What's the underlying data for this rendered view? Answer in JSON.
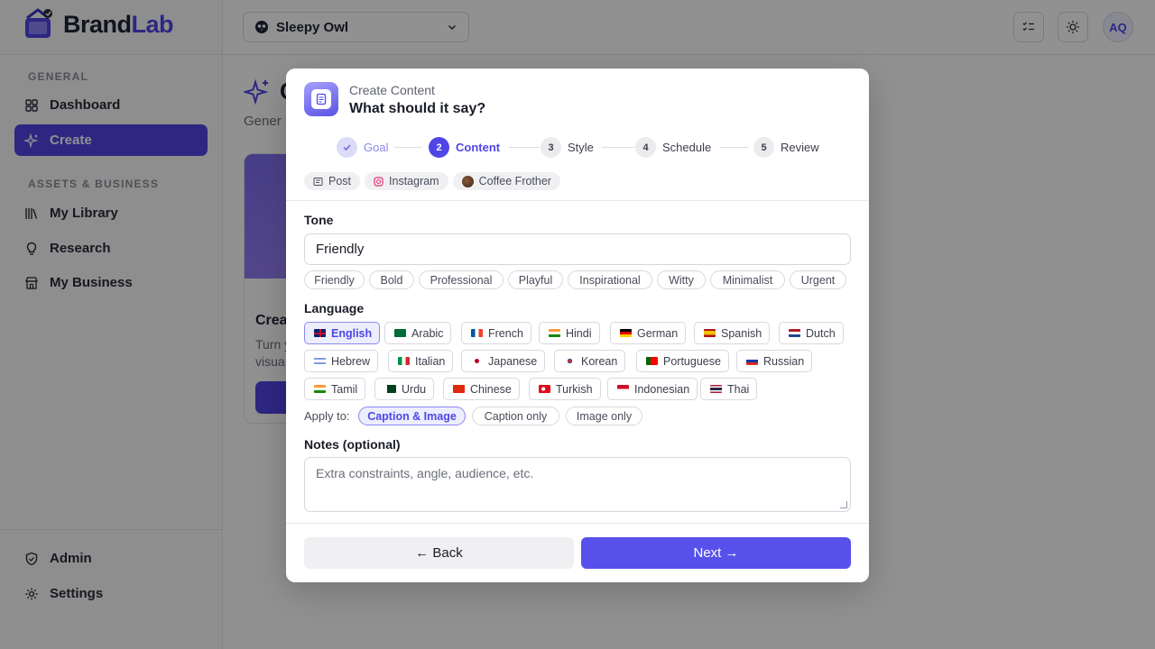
{
  "app": {
    "brand": "Brand",
    "brand_accent": "Lab"
  },
  "sidebar": {
    "section_general": "GENERAL",
    "section_assets": "ASSETS & BUSINESS",
    "items": [
      {
        "label": "Dashboard",
        "icon": "grid-icon"
      },
      {
        "label": "Create",
        "icon": "sparkle-icon",
        "active": true
      },
      {
        "label": "My Library",
        "icon": "library-icon"
      },
      {
        "label": "Research",
        "icon": "lightbulb-icon"
      },
      {
        "label": "My Business",
        "icon": "store-icon"
      },
      {
        "label": "Admin",
        "icon": "shield-icon"
      },
      {
        "label": "Settings",
        "icon": "gear-icon"
      }
    ]
  },
  "topbar": {
    "workspace": "Sleepy Owl",
    "avatar_initials": "AQ"
  },
  "page": {
    "title": "C",
    "subtitle": "Gener",
    "card_title": "Crea",
    "card_desc_line1": "Turn y",
    "card_desc_line2": "visua"
  },
  "modal": {
    "kicker": "Create Content",
    "title": "What should it say?",
    "steps": [
      {
        "num": "✓",
        "label": "Goal",
        "state": "done"
      },
      {
        "num": "2",
        "label": "Content",
        "state": "active"
      },
      {
        "num": "3",
        "label": "Style",
        "state": "todo"
      },
      {
        "num": "4",
        "label": "Schedule",
        "state": "todo"
      },
      {
        "num": "5",
        "label": "Review",
        "state": "todo"
      }
    ],
    "chips": [
      "Post",
      "Instagram",
      "Coffee Frother"
    ],
    "tone_label": "Tone",
    "tone_value": "Friendly",
    "tones": [
      "Friendly",
      "Bold",
      "Professional",
      "Playful",
      "Inspirational",
      "Witty",
      "Minimalist",
      "Urgent"
    ],
    "language_label": "Language",
    "languages": [
      "English",
      "Arabic",
      "French",
      "Hindi",
      "German",
      "Spanish",
      "Dutch",
      "Hebrew",
      "Italian",
      "Japanese",
      "Korean",
      "Portuguese",
      "Russian",
      "Tamil",
      "Urdu",
      "Chinese",
      "Turkish",
      "Indonesian",
      "Thai"
    ],
    "selected_language": "English",
    "apply_label": "Apply to:",
    "apply_options": [
      "Caption & Image",
      "Caption only",
      "Image only"
    ],
    "apply_selected": "Caption & Image",
    "notes_label": "Notes (optional)",
    "notes_placeholder": "Extra constraints, angle, audience, etc.",
    "back_label": "← Back",
    "next_label": "Next →"
  },
  "colors": {
    "accent": "#4f46e5",
    "next_button": "#5850ea",
    "overlay": "rgba(0,0,0,0.43)"
  }
}
